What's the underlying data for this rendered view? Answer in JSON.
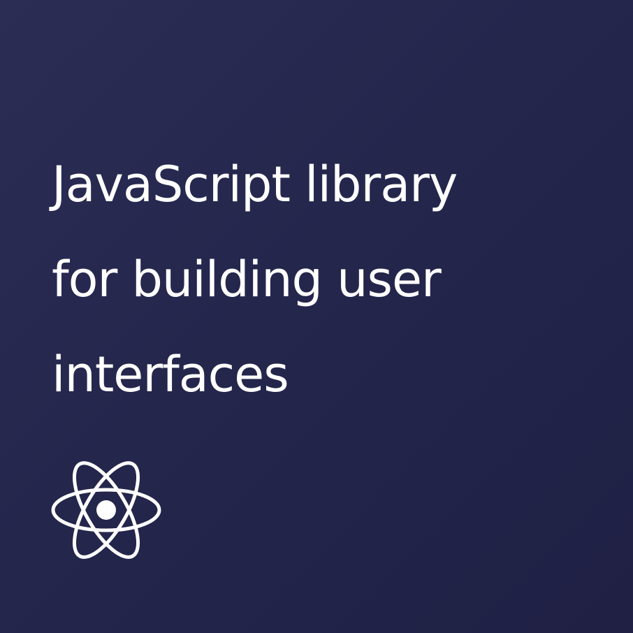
{
  "headline": {
    "lines": [
      "JavaScript library",
      "for building user",
      "interfaces"
    ]
  },
  "logo": {
    "icon": "react-atom-icon",
    "color": "#ffffff"
  },
  "background": {
    "from": "#2b2d55",
    "to": "#1f2044"
  }
}
